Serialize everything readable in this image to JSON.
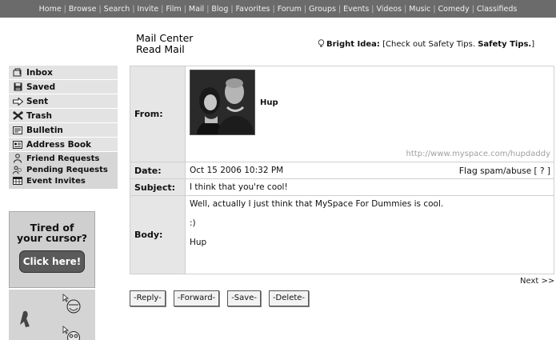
{
  "nav": [
    "Home",
    "Browse",
    "Search",
    "Invite",
    "Film",
    "Mail",
    "Blog",
    "Favorites",
    "Forum",
    "Groups",
    "Events",
    "Videos",
    "Music",
    "Comedy",
    "Classifieds"
  ],
  "heading": {
    "line1": "Mail Center",
    "line2": "Read Mail"
  },
  "bright_idea": {
    "label": "Bright Idea:",
    "text": "[Check out Safety Tips.",
    "link": "Safety Tips.",
    "close": "]"
  },
  "sidebar": {
    "items": [
      {
        "label": "Inbox",
        "icon": "inbox-icon"
      },
      {
        "label": "Saved",
        "icon": "floppy-disk-icon"
      },
      {
        "label": "Sent",
        "icon": "arrow-right-icon"
      },
      {
        "label": "Trash",
        "icon": "trash-icon"
      },
      {
        "label": "Bulletin",
        "icon": "bulletin-icon"
      },
      {
        "label": "Address Book",
        "icon": "address-book-icon"
      }
    ],
    "sub_items": [
      {
        "label": "Friend Requests",
        "icon": "people-icon"
      },
      {
        "label": "Pending Requests",
        "icon": "people-pending-icon"
      },
      {
        "label": "Event Invites",
        "icon": "calendar-icon"
      }
    ]
  },
  "ad": {
    "line1": "Tired of",
    "line2": "your cursor?",
    "button": "Click here!"
  },
  "message": {
    "labels": {
      "from": "From:",
      "date": "Date:",
      "subject": "Subject:",
      "body": "Body:"
    },
    "from_name": "Hup",
    "from_url": "http://www.myspace.com/hupdaddy",
    "date": "Oct 15 2006 10:32 PM",
    "flag_label": "Flag",
    "flag_text": "spam/abuse",
    "flag_help": "[ ? ]",
    "subject": "I think that you're cool!",
    "body_lines": [
      "Well, actually I just think that MySpace For Dummies is cool.",
      ":)",
      "Hup"
    ]
  },
  "next": "Next >>",
  "actions": {
    "reply": "-Reply-",
    "forward": "-Forward-",
    "save": "-Save-",
    "delete": "-Delete-"
  }
}
